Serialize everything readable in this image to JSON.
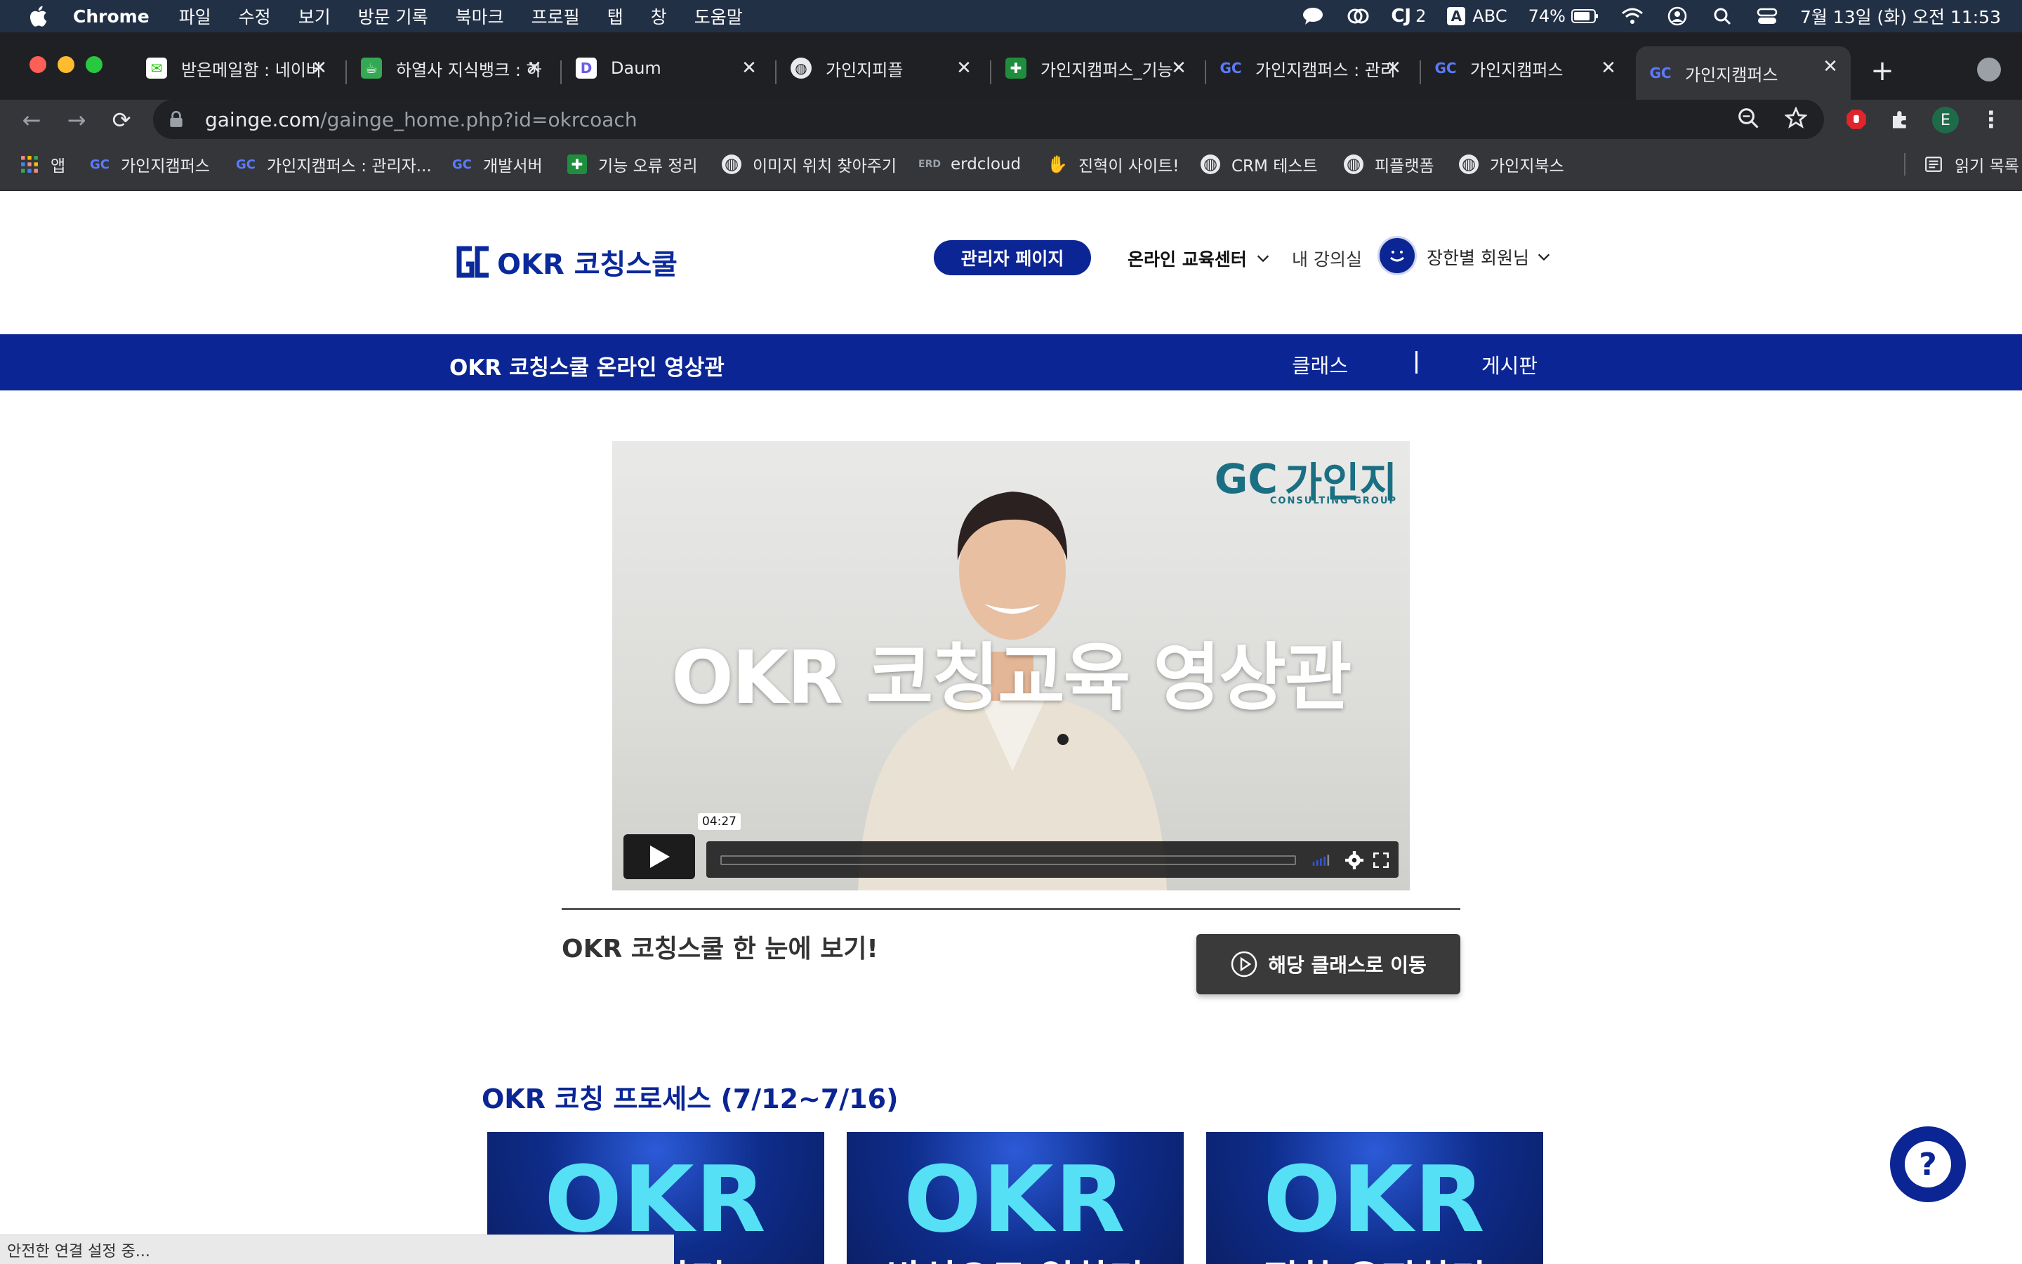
{
  "menubar": {
    "app": "Chrome",
    "items": [
      "파일",
      "수정",
      "보기",
      "방문 기록",
      "북마크",
      "프로필",
      "탭",
      "창",
      "도움말"
    ],
    "cj_count": "2",
    "input_source": "ABC",
    "battery": "74%",
    "clock": "7월 13일 (화) 오전 11:53"
  },
  "tabs": [
    {
      "title": "받은메일함 : 네이버",
      "icon": "mail-icon"
    },
    {
      "title": "하열사 지식뱅크 : 하",
      "icon": "cup-icon"
    },
    {
      "title": "Daum",
      "icon": "daum-icon"
    },
    {
      "title": "가인지피플",
      "icon": "globe-icon"
    },
    {
      "title": "가인지캠퍼스_기능",
      "icon": "sheets-icon"
    },
    {
      "title": "가인지캠퍼스 : 관리",
      "icon": "gc-icon"
    },
    {
      "title": "가인지캠퍼스",
      "icon": "gc-icon"
    },
    {
      "title": "가인지캠퍼스",
      "icon": "gc-icon"
    }
  ],
  "address": {
    "host": "gainge.com",
    "path": "/gainge_home.php?id=okrcoach"
  },
  "profile_initial": "E",
  "bookmarks": [
    {
      "label": "앱",
      "icon": "apps-grid-icon"
    },
    {
      "label": "가인지캠퍼스",
      "icon": "gc-icon"
    },
    {
      "label": "가인지캠퍼스 : 관리자...",
      "icon": "gc-icon"
    },
    {
      "label": "개발서버",
      "icon": "gc-icon"
    },
    {
      "label": "기능 오류 정리",
      "icon": "sheets-icon"
    },
    {
      "label": "이미지 위치 찾아주기",
      "icon": "globe-icon"
    },
    {
      "label": "erdcloud",
      "icon": "erd-icon"
    },
    {
      "label": "진혁이 사이트!",
      "icon": "wave-hand-icon"
    },
    {
      "label": "CRM 테스트",
      "icon": "globe-icon"
    },
    {
      "label": "피플랫폼",
      "icon": "globe-icon"
    },
    {
      "label": "가인지북스",
      "icon": "globe-icon"
    }
  ],
  "reading_list": "읽기 목록",
  "site": {
    "logo_text": "OKR 코칭스쿨",
    "admin_button": "관리자 페이지",
    "nav_online": "온라인 교육센터",
    "nav_my": "내 강의실",
    "member_name": "장한별 회원님",
    "banner_title": "OKR 코칭스쿨 온라인 영상관",
    "banner_class": "클래스",
    "banner_board": "게시판"
  },
  "video": {
    "brand": "가인지",
    "brand_sub": "CONSULTING GROUP",
    "title": "OKR 코칭교육 영상관",
    "duration": "04:27"
  },
  "caption": "OKR 코칭스쿨 한 눈에 보기!",
  "goto_button": "해당 클래스로 이동",
  "process_title": "OKR 코칭 프로세스 (7/12~7/16)",
  "cards": [
    {
      "big": "OKR",
      "sub": "설정하기"
    },
    {
      "big": "OKR",
      "sub": "방식으로 일하기"
    },
    {
      "big": "OKR",
      "sub": "정착 유지하기"
    }
  ],
  "help_glyph": "?",
  "status": "안전한 연결 설정 중...",
  "colors": {
    "brand_blue": "#0b2595",
    "accent_cyan": "#56e0f5"
  }
}
